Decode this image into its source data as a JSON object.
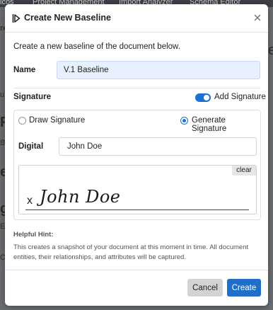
{
  "background": {
    "topbar_items": [
      "lcos",
      "Project Management",
      "Import Analyzer",
      "Schema Editor"
    ],
    "side_fragments": [
      "re",
      "u",
      "F",
      "B",
      "er",
      "gi",
      "Ea",
      "C"
    ],
    "right_fragment": "e"
  },
  "modal": {
    "title": "Create New Baseline",
    "intro": "Create a new baseline of the document below.",
    "name_label": "Name",
    "name_value": "V.1 Baseline",
    "signature_label": "Signature",
    "add_signature_label": "Add Signature",
    "add_signature_enabled": true,
    "draw_signature_label": "Draw Signature",
    "generate_signature_label": "Generate Signature",
    "selected_mode": "Generate Signature",
    "digital_label": "Digital",
    "digital_value": "John Doe",
    "clear_label": "clear",
    "signature_prefix": "x",
    "signature_render": "John Doe",
    "hint_title": "Helpful Hint:",
    "hint_text": "This creates a snapshot of your document at this moment in time. All document entities, their relationships, and attributes will be captured.",
    "cancel_label": "Cancel",
    "create_label": "Create"
  },
  "colors": {
    "accent": "#1f6fc9",
    "name_input_bg": "#e8f0fd",
    "cancel_bg": "#d3d3d3"
  }
}
